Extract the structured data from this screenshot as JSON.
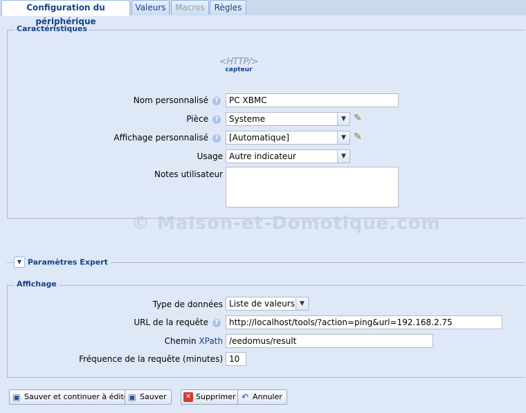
{
  "tabs": [
    {
      "label": "Configuration du périphérique",
      "active": true
    },
    {
      "label": "Valeurs"
    },
    {
      "label": "Macros",
      "disabled": true
    },
    {
      "label": "Règles"
    }
  ],
  "characteristics": {
    "legend": "Caractéristiques",
    "device_icon_text": "<HTTP/>",
    "device_caption": "capteur",
    "name_label": "Nom personnalisé",
    "name_value": "PC XBMC",
    "room_label": "Pièce",
    "room_value": "Systeme",
    "display_label": "Affichage personnalisé",
    "display_value": "[Automatique]",
    "usage_label": "Usage",
    "usage_value": "Autre indicateur",
    "notes_label": "Notes utilisateur",
    "notes_value": ""
  },
  "expert": {
    "label": "Paramètres Expert"
  },
  "display_section": {
    "legend": "Affichage",
    "data_type_label": "Type de données",
    "data_type_value": "Liste de valeurs",
    "url_label": "URL de la requête",
    "url_value": "http://localhost/tools/?action=ping&url=192.168.2.75",
    "xpath_label_prefix": "Chemin",
    "xpath_label_link": "XPath",
    "xpath_value": "/eedomus/result",
    "freq_label": "Fréquence de la requête (minutes)",
    "freq_value": "10"
  },
  "buttons": {
    "save_continue": "Sauver et continuer à éditer",
    "save": "Sauver",
    "delete": "Supprimer",
    "cancel": "Annuler"
  },
  "watermark": "© Maison-et-Domotique.com",
  "colors": {
    "accent": "#15428b",
    "background": "#dfe8f6"
  }
}
